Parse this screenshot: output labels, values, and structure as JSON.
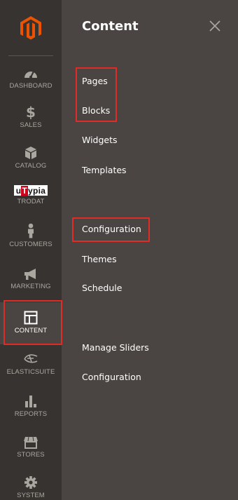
{
  "sidebar": {
    "items": [
      {
        "id": "dashboard",
        "label": "DASHBOARD",
        "icon": "dashboard-gauge-icon"
      },
      {
        "id": "sales",
        "label": "SALES",
        "icon": "dollar-icon"
      },
      {
        "id": "catalog",
        "label": "CATALOG",
        "icon": "box-icon"
      },
      {
        "id": "trodat",
        "label": "TRODAT",
        "badge": {
          "u": "u",
          "t": "T",
          "rest": "ypia"
        }
      },
      {
        "id": "customers",
        "label": "CUSTOMERS",
        "icon": "person-icon"
      },
      {
        "id": "marketing",
        "label": "MARKETING",
        "icon": "megaphone-icon"
      },
      {
        "id": "content",
        "label": "CONTENT",
        "icon": "layout-icon",
        "active": true
      },
      {
        "id": "elasticsuite",
        "label": "ELASTICSUITE",
        "icon": "elasticsuite-icon"
      },
      {
        "id": "reports",
        "label": "REPORTS",
        "icon": "bar-chart-icon"
      },
      {
        "id": "stores",
        "label": "STORES",
        "icon": "store-icon"
      },
      {
        "id": "system",
        "label": "SYSTEM",
        "icon": "gear-icon"
      }
    ]
  },
  "flyout": {
    "title": "Content",
    "close_symbol": "×",
    "groups": [
      {
        "links": [
          "Pages",
          "Blocks",
          "Widgets",
          "Templates"
        ]
      },
      {
        "links": [
          "Configuration",
          "Themes",
          "Schedule"
        ]
      },
      {
        "links": [
          "Manage Sliders",
          "Configuration"
        ]
      }
    ]
  },
  "colors": {
    "rail_bg": "#373330",
    "flyout_bg": "#4a4542",
    "brand_orange": "#eb5202",
    "annotation_red": "#e02b27",
    "rail_text": "#aaa6a0"
  }
}
